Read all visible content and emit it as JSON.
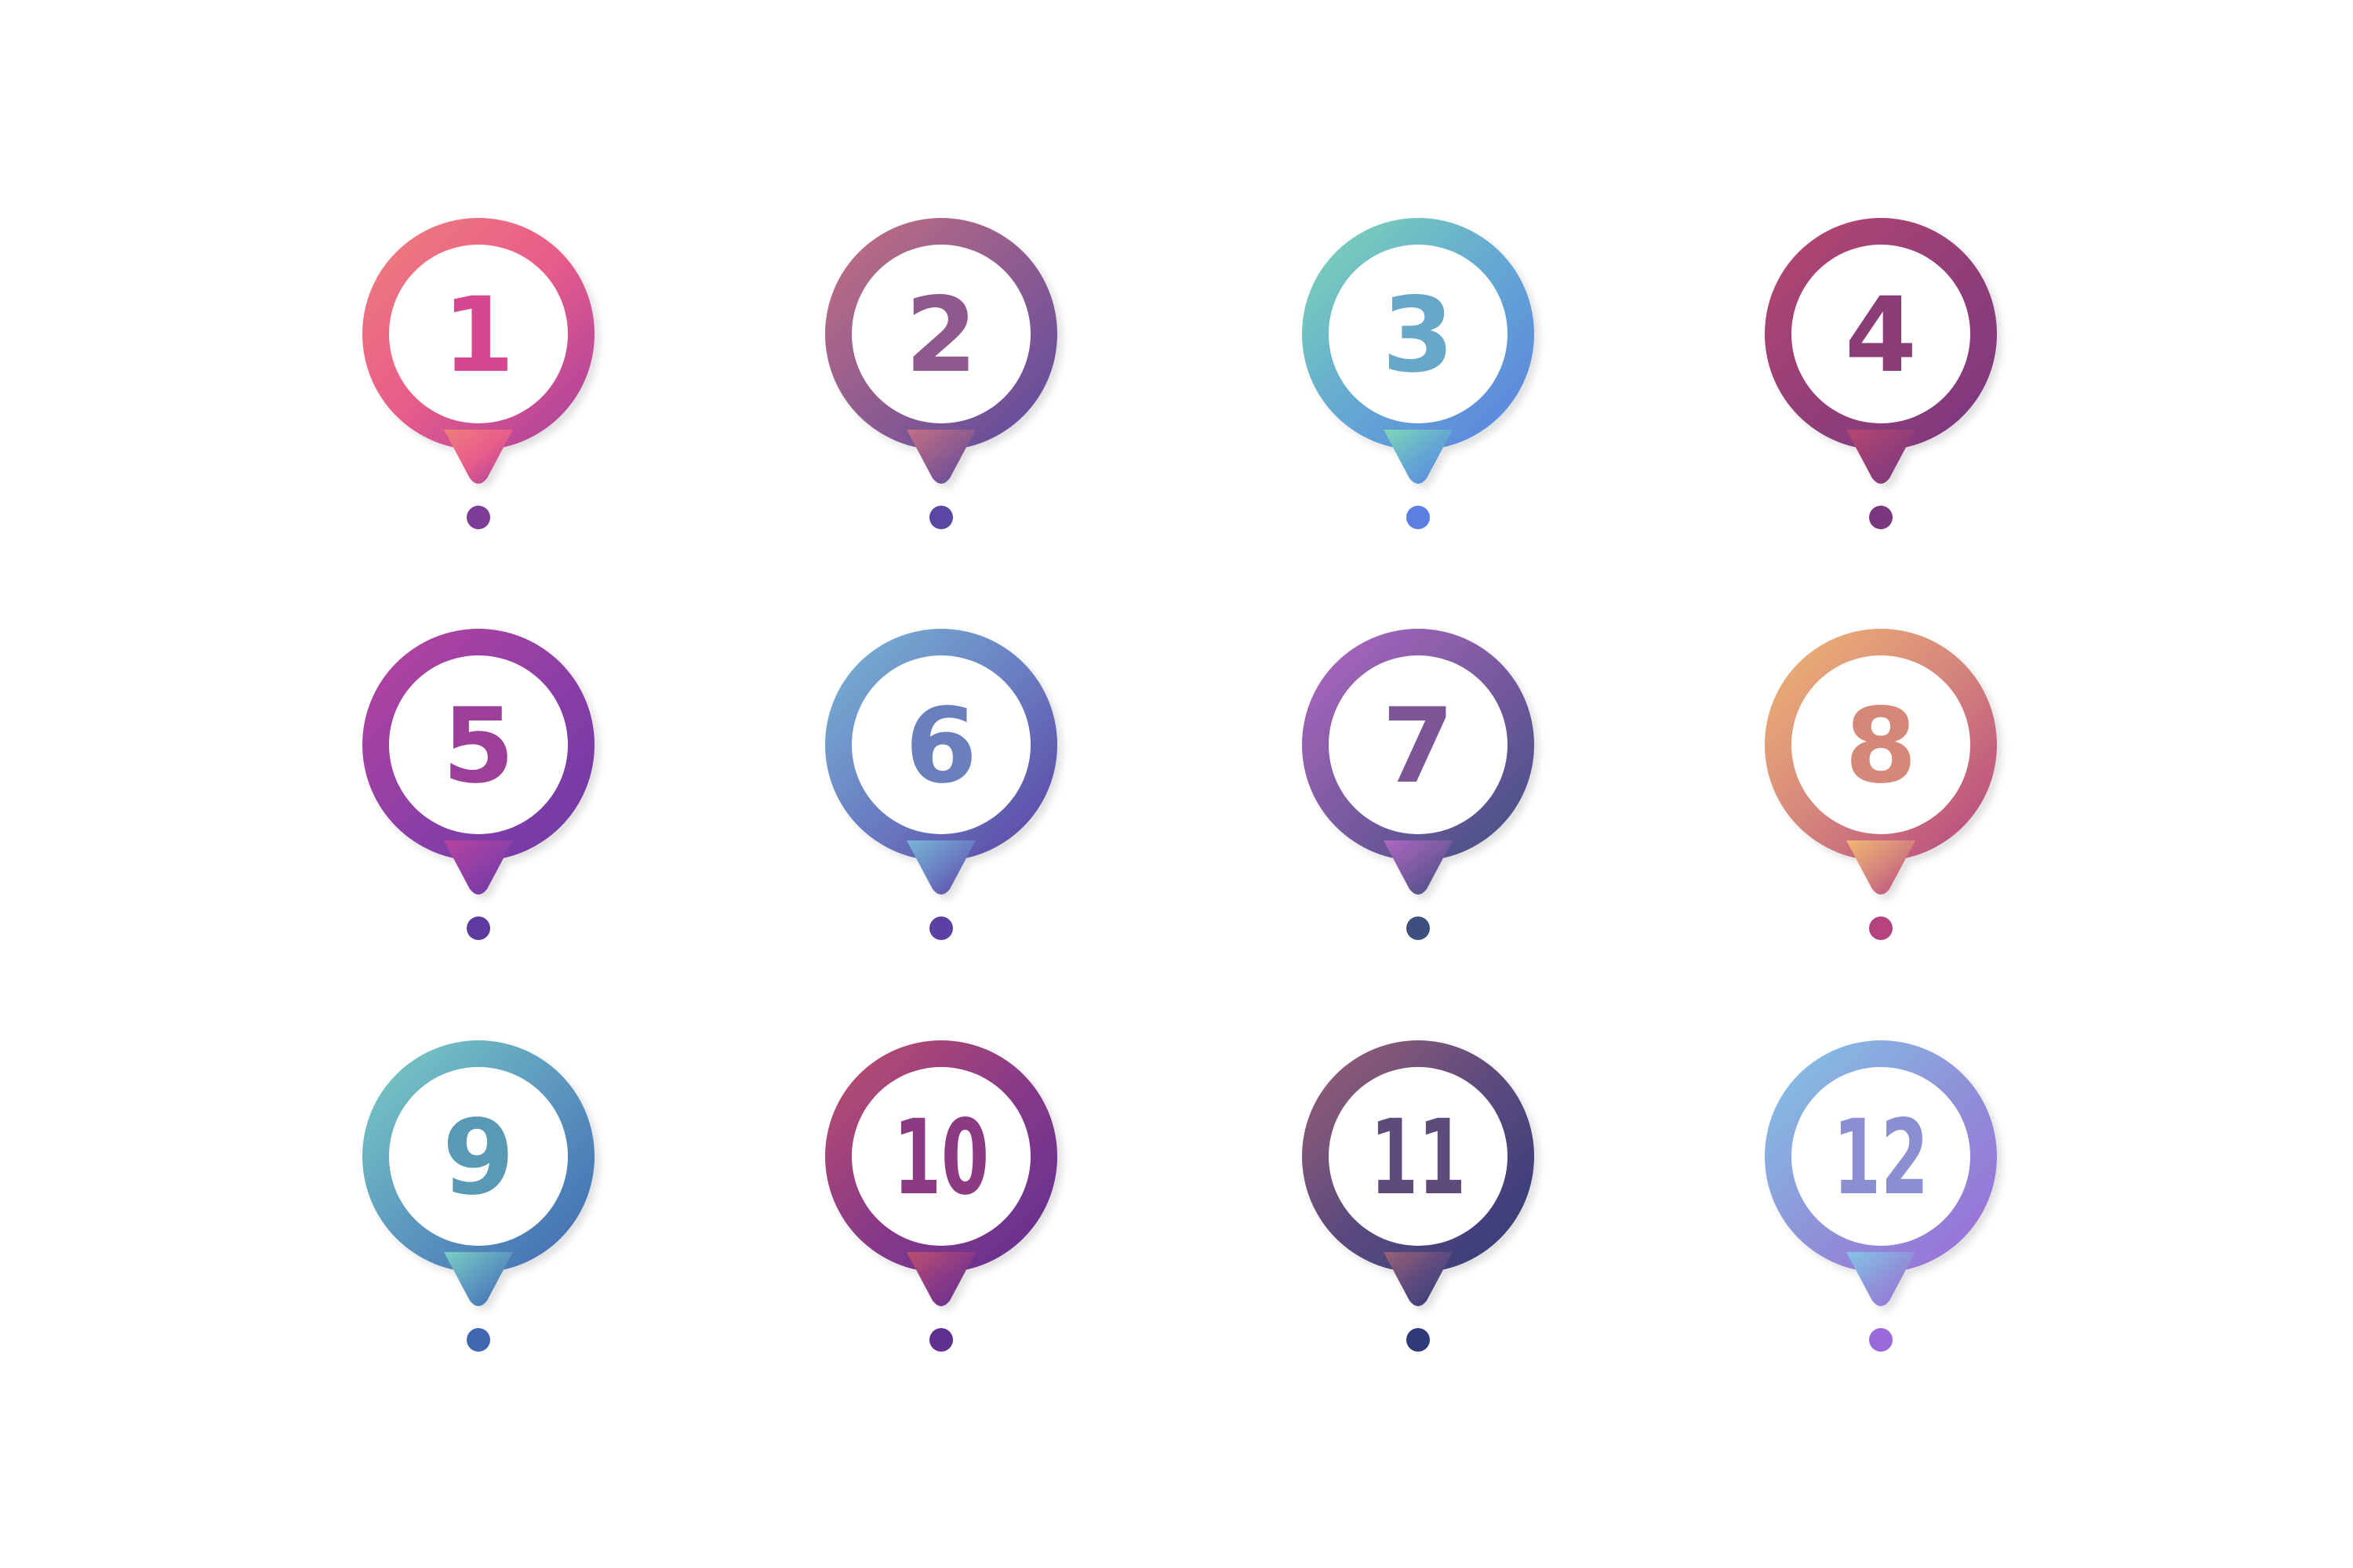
{
  "markers": [
    {
      "label": "1",
      "colors": [
        "#ee7f7b",
        "#e85c8a",
        "#a33f9f"
      ],
      "number_color": "#d6478f",
      "dot_color": "#7c3c98"
    },
    {
      "label": "2",
      "colors": [
        "#c57082",
        "#8f5c8f",
        "#5b4aa0"
      ],
      "number_color": "#8e5a8e",
      "dot_color": "#5a46a3"
    },
    {
      "label": "3",
      "colors": [
        "#7fd7b4",
        "#64a9d2",
        "#5a7fe0"
      ],
      "number_color": "#67a7c7",
      "dot_color": "#5a7fe0"
    },
    {
      "label": "4",
      "colors": [
        "#b8476f",
        "#933f78",
        "#7a367f"
      ],
      "number_color": "#8b3d78",
      "dot_color": "#7a367f"
    },
    {
      "label": "5",
      "colors": [
        "#b8449f",
        "#8f3fa6",
        "#6a38a5"
      ],
      "number_color": "#9b3f98",
      "dot_color": "#5d3aa0"
    },
    {
      "label": "6",
      "colors": [
        "#78b7d6",
        "#6a7fc2",
        "#5a41a2"
      ],
      "number_color": "#6a80bd",
      "dot_color": "#5a41a2"
    },
    {
      "label": "7",
      "colors": [
        "#b068c2",
        "#7a5aa0",
        "#3e4f82"
      ],
      "number_color": "#7c5597",
      "dot_color": "#3d4f7e"
    },
    {
      "label": "8",
      "colors": [
        "#f0b872",
        "#d5857c",
        "#b4437f"
      ],
      "number_color": "#d68878",
      "dot_color": "#b4437f"
    },
    {
      "label": "9",
      "colors": [
        "#79cfc4",
        "#5c98bf",
        "#3f68b0"
      ],
      "number_color": "#5a99b5",
      "dot_color": "#3f68b0"
    },
    {
      "label": "10",
      "colors": [
        "#be4f6c",
        "#8a3a87",
        "#5f2f92"
      ],
      "number_color": "#8c3b82",
      "dot_color": "#5f2f92"
    },
    {
      "label": "11",
      "colors": [
        "#9a6074",
        "#5c4a7e",
        "#2f3a78"
      ],
      "number_color": "#5f4a7c",
      "dot_color": "#2f3a78"
    },
    {
      "label": "12",
      "colors": [
        "#82c7e8",
        "#8e94d8",
        "#9b6ad8"
      ],
      "number_color": "#8b8fd2",
      "dot_color": "#9b6ad8"
    }
  ]
}
